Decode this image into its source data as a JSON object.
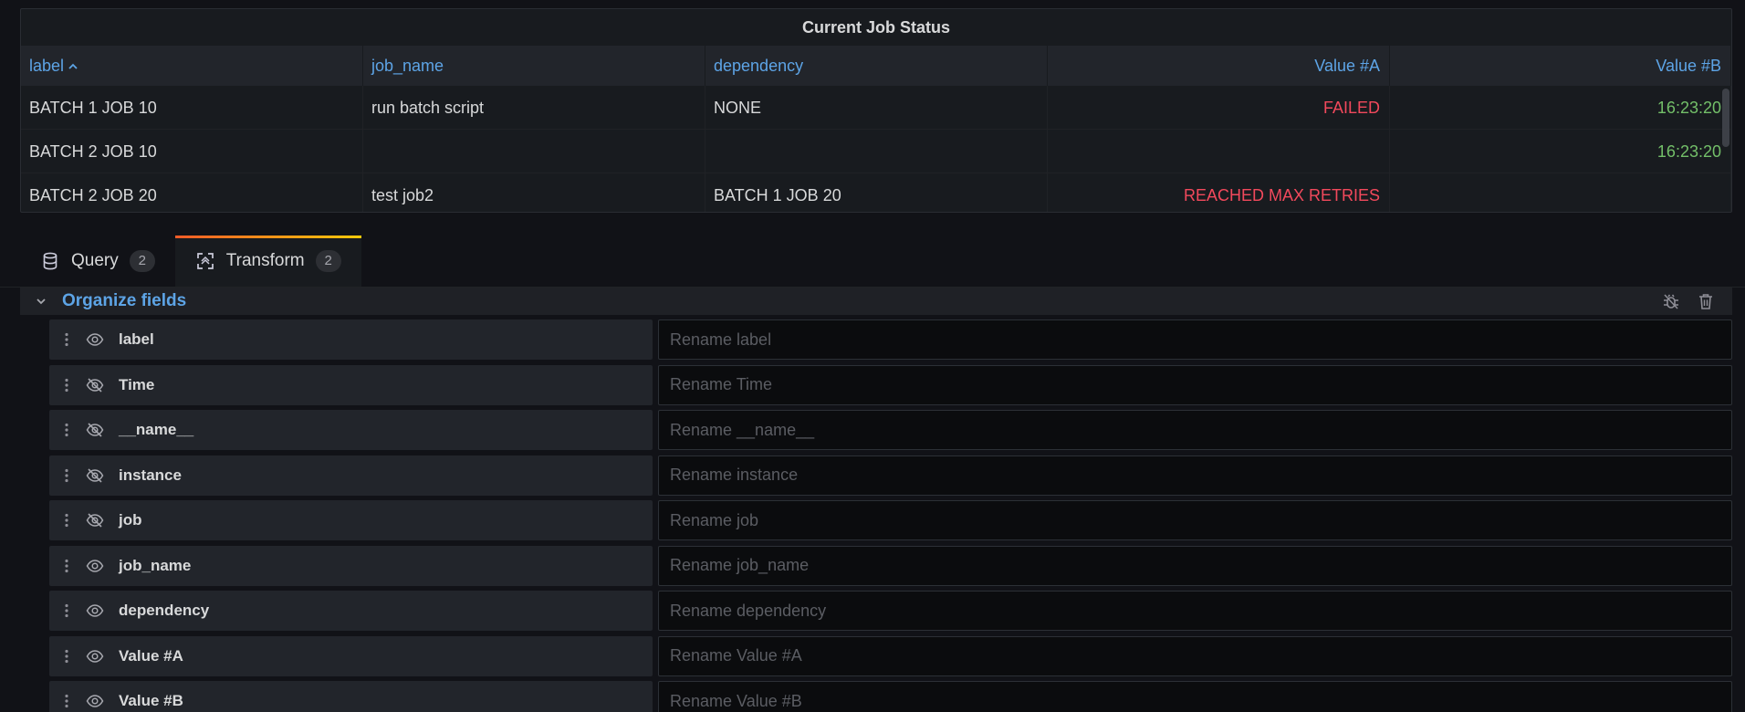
{
  "panel": {
    "title": "Current Job Status",
    "columns": [
      {
        "label": "label",
        "sort": "ascending"
      },
      {
        "label": "job_name"
      },
      {
        "label": "dependency"
      },
      {
        "label": "Value #A"
      },
      {
        "label": "Value #B"
      }
    ],
    "rows": [
      {
        "label": "BATCH 1 JOB 10",
        "job_name": "run batch script",
        "dependency": "NONE",
        "value_a": "FAILED",
        "value_b": "16:23:20"
      },
      {
        "label": "BATCH 2 JOB 10",
        "job_name": "",
        "dependency": "",
        "value_a": "",
        "value_b": "16:23:20"
      },
      {
        "label": "BATCH 2 JOB 20",
        "job_name": "test job2",
        "dependency": "BATCH 1 JOB 20",
        "value_a": "REACHED MAX RETRIES",
        "value_b": ""
      }
    ],
    "colors": {
      "failed": "#f2495c",
      "ok": "#73bf69",
      "header_link": "#5da4e6"
    }
  },
  "tabs": [
    {
      "label": "Query",
      "count": "2",
      "icon": "database-icon",
      "active": false
    },
    {
      "label": "Transform",
      "count": "2",
      "icon": "transform-icon",
      "active": true
    }
  ],
  "transform": {
    "title": "Organize fields",
    "actions": [
      "debug-icon",
      "trash-icon"
    ],
    "fields": [
      {
        "name": "label",
        "visible": true,
        "placeholder": "Rename label"
      },
      {
        "name": "Time",
        "visible": false,
        "placeholder": "Rename Time"
      },
      {
        "name": "__name__",
        "visible": false,
        "placeholder": "Rename __name__"
      },
      {
        "name": "instance",
        "visible": false,
        "placeholder": "Rename instance"
      },
      {
        "name": "job",
        "visible": false,
        "placeholder": "Rename job"
      },
      {
        "name": "job_name",
        "visible": true,
        "placeholder": "Rename job_name"
      },
      {
        "name": "dependency",
        "visible": true,
        "placeholder": "Rename dependency"
      },
      {
        "name": "Value #A",
        "visible": true,
        "placeholder": "Rename Value #A"
      },
      {
        "name": "Value #B",
        "visible": true,
        "placeholder": "Rename Value #B"
      }
    ]
  }
}
